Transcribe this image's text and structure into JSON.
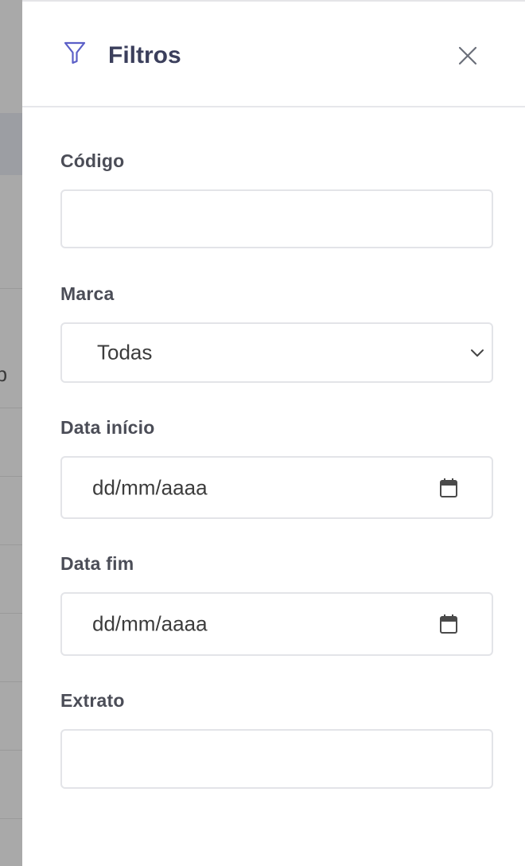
{
  "drawer": {
    "title": "Filtros"
  },
  "fields": {
    "codigo": {
      "label": "Código",
      "value": ""
    },
    "marca": {
      "label": "Marca",
      "selected": "Todas"
    },
    "data_inicio": {
      "label": "Data início",
      "placeholder": "dd/mm/aaaa"
    },
    "data_fim": {
      "label": "Data fim",
      "placeholder": "dd/mm/aaaa"
    },
    "extrato": {
      "label": "Extrato",
      "value": ""
    }
  },
  "background": {
    "partial_text": "rp"
  },
  "colors": {
    "accent": "#5b5fc7",
    "title": "#3b3f5c",
    "border": "#e3e4e8",
    "backdrop": "#a9a9a9"
  },
  "icons": {
    "header": "filter-icon",
    "close": "close-icon",
    "select": "chevron-down-icon",
    "date": "calendar-icon"
  }
}
